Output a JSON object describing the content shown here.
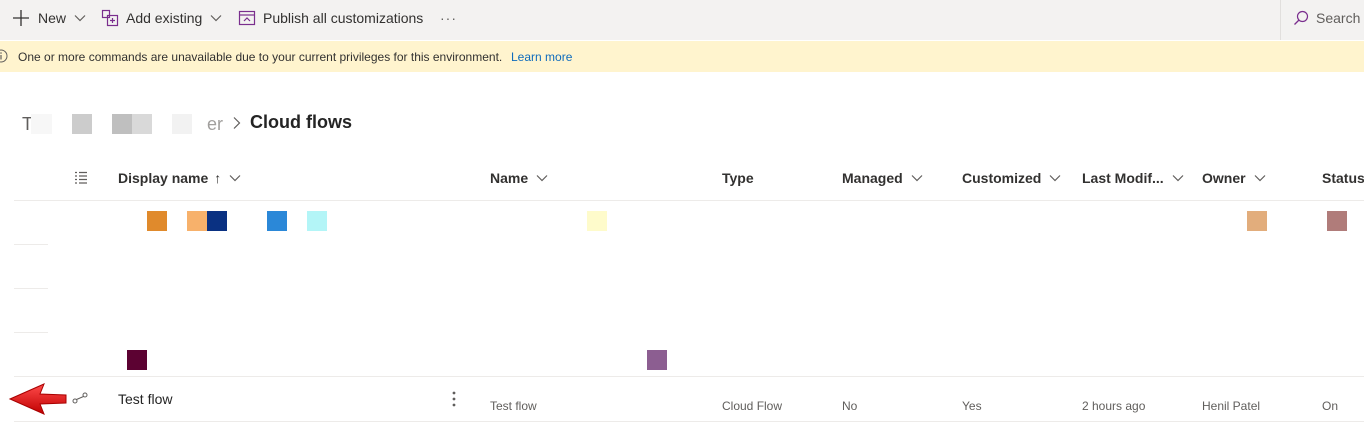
{
  "command_bar": {
    "new_label": "New",
    "add_existing_label": "Add existing",
    "publish_label": "Publish all customizations",
    "more_label": "···",
    "search_label": "Search"
  },
  "notice": {
    "message": "One or more commands are unavailable due to your current privileges for this environment.",
    "link_label": "Learn more"
  },
  "breadcrumb": {
    "first_visible": "T",
    "partial": "er",
    "current": "Cloud flows"
  },
  "table": {
    "columns": {
      "display_name": "Display name",
      "sort_glyph": "↑",
      "name": "Name",
      "type": "Type",
      "managed": "Managed",
      "customized": "Customized",
      "last_modified": "Last Modif...",
      "owner": "Owner",
      "status": "Status"
    },
    "row": {
      "display_name": "Test flow",
      "name": "Test flow",
      "type": "Cloud Flow",
      "managed": "No",
      "customized": "Yes",
      "last_modified": "2 hours ago",
      "owner": "Henil Patel",
      "status": "On"
    }
  },
  "colors": {
    "command_bar_bg": "#f3f2f1",
    "notice_bg": "#fff4ce",
    "link": "#0f6cbd",
    "arrow": "#e81123",
    "redaction_squares": [
      "#e08a2c",
      "#f7b16b",
      "#0a3182",
      "#2b88d8",
      "#b3f5f7",
      "#fefbcb",
      "#e2ad7c",
      "#b07c7a",
      "#5c0232",
      "#8c5e91"
    ]
  }
}
